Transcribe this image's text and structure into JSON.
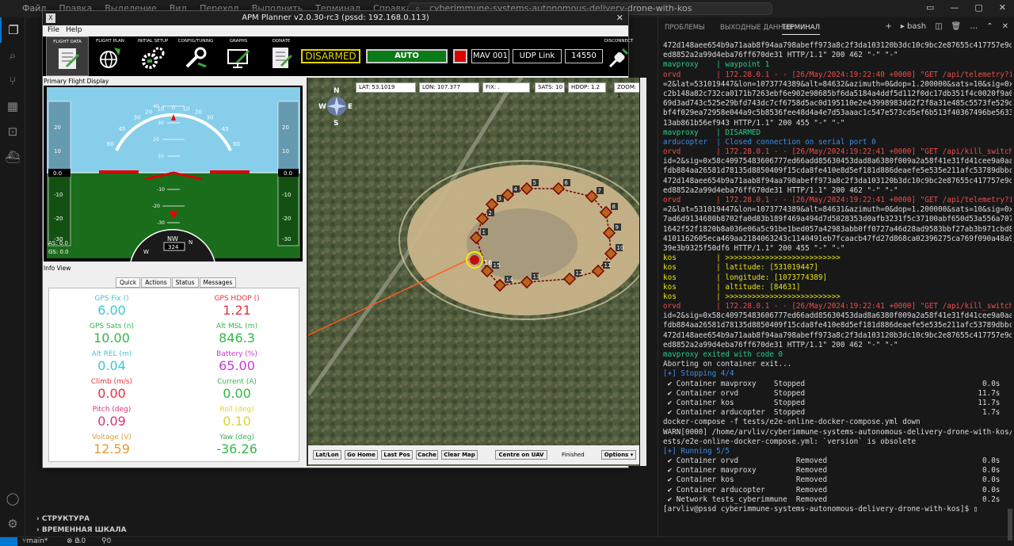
{
  "vscode": {
    "menu": [
      "Файл",
      "Правка",
      "Выделение",
      "Вид",
      "Переход",
      "Выполнить",
      "Терминал",
      "Справка"
    ],
    "search_text": "cyberimmune-systems-autonomous-delivery-drone-with-kos",
    "sidebar_sections": [
      "СТРУКТУРА",
      "ВРЕМЕННАЯ ШКАЛА"
    ],
    "status": {
      "branch": "main*",
      "errors": "0",
      "warnings": "0",
      "ports": "0"
    }
  },
  "panel": {
    "tabs": [
      "ПРОБЛЕМЫ",
      "ВЫХОДНЫЕ ДАННЫЕ",
      "ТЕРМИНАЛ"
    ],
    "shell": "bash",
    "lines": [
      {
        "t": "472d148aee654b9a71aab8f94aa798abeff973a8c2f3da103120b3dc10c9bc2e87655c417757e9d1",
        "c": "c-white"
      },
      {
        "t": "ed8852a2a99d4eba76ff670de31 HTTP/1.1\" 200 462 \"-\" \"-\"",
        "c": "c-white"
      },
      {
        "t": "mavproxy    | waypoint 1",
        "c": "c-green"
      },
      {
        "t": "orvd        | 172.28.0.1 - - [26/May/2024:19:22:40 +0000] \"GET /api/telemetry?id",
        "c": "c-red"
      },
      {
        "t": "=2&lat=531019447&lon=1073774389&alt=84632&azimuth=0&dop=1.200000&sats=10&sig=0x4",
        "c": "c-white"
      },
      {
        "t": "c2b148a82c732ca0171b7263ebf6e902e98685bf6da5184a4ddf5d112f0dc17db351f4c0020f9a088",
        "c": "c-white"
      },
      {
        "t": "69d3ad743c525e29bfd743dc7cf6758d5ac0d195110e2e43998983dd2f2f8a31e485c5573fe529d1",
        "c": "c-white"
      },
      {
        "t": "bf4f029ea72958e044a9c5b8536fee48d4a4e7d53aaac1c547e573cd5ef6b513f40367496be5633a",
        "c": "c-white"
      },
      {
        "t": "13ab861b56ef943 HTTP/1.1\" 200 455 \"-\" \"-\"",
        "c": "c-white"
      },
      {
        "t": "mavproxy    | DISARMED",
        "c": "c-green"
      },
      {
        "t": "arducopter  | Closed connection on serial port 0",
        "c": "c-blue"
      },
      {
        "t": "orvd        | 172.28.0.1 - - [26/May/2024:19:22:41 +0000] \"GET /api/kill_switch?",
        "c": "c-red"
      },
      {
        "t": "id=2&sig=0x58c40975483606777ed66add85630453dad8a6380f009a2a58f41e31fd41cee9a0aa9",
        "c": "c-white"
      },
      {
        "t": "fdb884aa26581d78135d8850409f15cda8fe410e8d5ef181d886deaefe5e535e211afc53789dbbcb",
        "c": "c-white"
      },
      {
        "t": "472d148aee654b9a71aab8f94aa798abeff973a8c2f3da103120b3dc10c9bc2e87655c417757e9d1",
        "c": "c-white"
      },
      {
        "t": "ed8852a2a99d4eba76ff670de31 HTTP/1.1\" 200 462 \"-\" \"-\"",
        "c": "c-white"
      },
      {
        "t": "orvd        | 172.28.0.1 - - [26/May/2024:19:22:41 +0000] \"GET /api/telemetry?id",
        "c": "c-red"
      },
      {
        "t": "=2&lat=531019447&lon=1073774389&alt=84631&azimuth=0&dop=1.200000&sats=10&sig=0xb",
        "c": "c-white"
      },
      {
        "t": "7ad6d9134680b8702fa0d83b189f469a494d7d5028353d0afb3231f5c37100abf650d53a556a7072",
        "c": "c-white"
      },
      {
        "t": "1642f52f1820b8a036e06a5c91be1bed057a42983abb0ff0727a46d28ad9583bbf27ab3b971cbd81",
        "c": "c-white"
      },
      {
        "t": "4101162605eca469aa2184063243c1140491eb7fcaacb47fd27d868ca02396275ca769f090a48a91",
        "c": "c-white"
      },
      {
        "t": "39e3b9325f50df6 HTTP/1.1\" 200 455 \"-\" \"-\"",
        "c": "c-white"
      },
      {
        "t": "kos         | >>>>>>>>>>>>>>>>>>>>>>>>>>",
        "c": "c-yellow"
      },
      {
        "t": "kos         | latitude: [531019447]",
        "c": "c-yellow"
      },
      {
        "t": "kos         | longitude: [1073774389]",
        "c": "c-yellow"
      },
      {
        "t": "kos         | altitude: [84631]",
        "c": "c-yellow"
      },
      {
        "t": "kos         | >>>>>>>>>>>>>>>>>>>>>>>>>>",
        "c": "c-yellow"
      },
      {
        "t": "orvd        | 172.28.0.1 - - [26/May/2024:19:22:41 +0000] \"GET /api/kill_switch?",
        "c": "c-red"
      },
      {
        "t": "id=2&sig=0x58c40975483606777ed66add85630453dad8a6380f009a2a58f41e31fd41cee9a0aa9",
        "c": "c-white"
      },
      {
        "t": "fdb884aa26581d78135d8850409f15cda8fe410e8d5ef181d886deaefe5e535e211afc53789dbbcb",
        "c": "c-white"
      },
      {
        "t": "472d148aee654b9a71aab8f94aa798abeff973a8c2f3da103120b3dc10c9bc2e87655c417757e9d1",
        "c": "c-white"
      },
      {
        "t": "ed8852a2a99d4eba76ff670de31 HTTP/1.1\" 200 462 \"-\" \"-\"",
        "c": "c-white"
      },
      {
        "t": "mavproxy exited with code 0",
        "c": "c-green"
      },
      {
        "t": "Aborting on container exit...",
        "c": "c-white"
      },
      {
        "t": "[+] Stopping 4/4",
        "c": "c-blue"
      },
      {
        "t": " ✔ Container mavproxy    Stopped                                        0.0s",
        "c": "c-white"
      },
      {
        "t": " ✔ Container orvd        Stopped                                       11.7s",
        "c": "c-white"
      },
      {
        "t": " ✔ Container kos         Stopped                                       11.7s",
        "c": "c-white"
      },
      {
        "t": " ✔ Container arducopter  Stopped                                        1.7s",
        "c": "c-white"
      },
      {
        "t": "docker-compose -f tests/e2e-online-docker-compose.yml down",
        "c": "c-white"
      },
      {
        "t": "WARN[0000] /home/arvliv/cyberimmune-systems-autonomous-delivery-drone-with-kos/t",
        "c": "c-white"
      },
      {
        "t": "ests/e2e-online-docker-compose.yml: `version` is obsolete",
        "c": "c-white"
      },
      {
        "t": "[+] Running 5/5",
        "c": "c-blue"
      },
      {
        "t": " ✔ Container orvd             Removed                                   0.0s",
        "c": "c-white"
      },
      {
        "t": " ✔ Container mavproxy         Removed                                   0.0s",
        "c": "c-white"
      },
      {
        "t": " ✔ Container kos              Removed                                   0.0s",
        "c": "c-white"
      },
      {
        "t": " ✔ Container arducopter       Removed                                   0.0s",
        "c": "c-white"
      },
      {
        "t": " ✔ Network tests_cyberimmune  Removed                                   0.2s",
        "c": "c-white"
      },
      {
        "t": "[arvliv@pssd cyberimmune-systems-autonomous-delivery-drone-with-kos]$ ▯",
        "c": "c-white"
      }
    ]
  },
  "apm": {
    "title": "APM Planner v2.0.30-rc3 (pssd: 192.168.0.113)",
    "menu": [
      "File",
      "Help"
    ],
    "toolbar": [
      "FLIGHT DATA",
      "FLIGHT PLAN",
      "INITIAL SETUP",
      "CONFIG/TUNING",
      "GRAPHS",
      "DONATE"
    ],
    "disconnect": "DISCONNECT",
    "armed_state": "DISARMED",
    "mode": "AUTO",
    "mav": "MAV 001",
    "link": "UDP Link",
    "port": "14550",
    "pfd_title": "Primary Flight Display",
    "pfd": {
      "as": "AS: 0.0",
      "gs": "GS: 0.0",
      "heading": "324",
      "alt_readout": "0.0",
      "spd_readout": "0.0",
      "roll_scale": [
        "60",
        "45",
        "30",
        "20",
        "10",
        "0",
        "10",
        "20",
        "30",
        "45",
        "60"
      ],
      "pitch_scale": [
        "40",
        "30",
        "20",
        "10",
        "-10",
        "-20",
        "-30",
        "-40"
      ],
      "left_tape": [
        "20",
        "10",
        "-10",
        "-20",
        "-30"
      ],
      "right_tape": [
        "20",
        "10",
        "-10",
        "-20",
        "-30"
      ],
      "compass": [
        "NW",
        "W",
        "N"
      ]
    },
    "info_title": "Info View",
    "info_tabs": [
      "Quick",
      "Actions",
      "Status",
      "Messages"
    ],
    "quick": [
      {
        "label": "GPS Fix ()",
        "value": "6.00",
        "color": "#3fc6d6"
      },
      {
        "label": "GPS HDOP ()",
        "value": "1.21",
        "color": "#e6343c"
      },
      {
        "label": "GPS Sats (n)",
        "value": "10.00",
        "color": "#35b64a"
      },
      {
        "label": "Alt MSL (m)",
        "value": "846.3",
        "color": "#35b64a"
      },
      {
        "label": "Alt REL (m)",
        "value": "0.04",
        "color": "#3fc6d6"
      },
      {
        "label": "Battery (%)",
        "value": "65.00",
        "color": "#c63ad6"
      },
      {
        "label": "Climb (m/s)",
        "value": "0.00",
        "color": "#e6343c"
      },
      {
        "label": "Current (A)",
        "value": "0.00",
        "color": "#35b64a"
      },
      {
        "label": "Pitch (deg)",
        "value": "0.09",
        "color": "#d6337a"
      },
      {
        "label": "Roll (deg)",
        "value": "0.10",
        "color": "#d6d63a"
      },
      {
        "label": "Voltage (V)",
        "value": "12.59",
        "color": "#e69a35"
      },
      {
        "label": "Yaw (deg)",
        "value": "-36.26",
        "color": "#35b64a"
      }
    ],
    "map": {
      "lat": "LAT: 53.1019",
      "lon": "LON: 107.377",
      "fix": "FIX: .",
      "sats": "SATS: 10",
      "hdop": "HDOP: 1.2",
      "zoom": "ZOOM: 1",
      "buttons": [
        "Lat/Lon",
        "Go Home",
        "Last Pos",
        "Cache",
        "Clear Map",
        "Centre on UAV"
      ],
      "status": "Finished",
      "options": "Options ▾",
      "compass": [
        "N",
        "W",
        "E",
        "S"
      ],
      "waypoints": [
        "1",
        "2",
        "3",
        "4",
        "5",
        "6",
        "7",
        "8",
        "9",
        "10",
        "11",
        "12",
        "13",
        "14",
        "15",
        "16"
      ]
    }
  }
}
